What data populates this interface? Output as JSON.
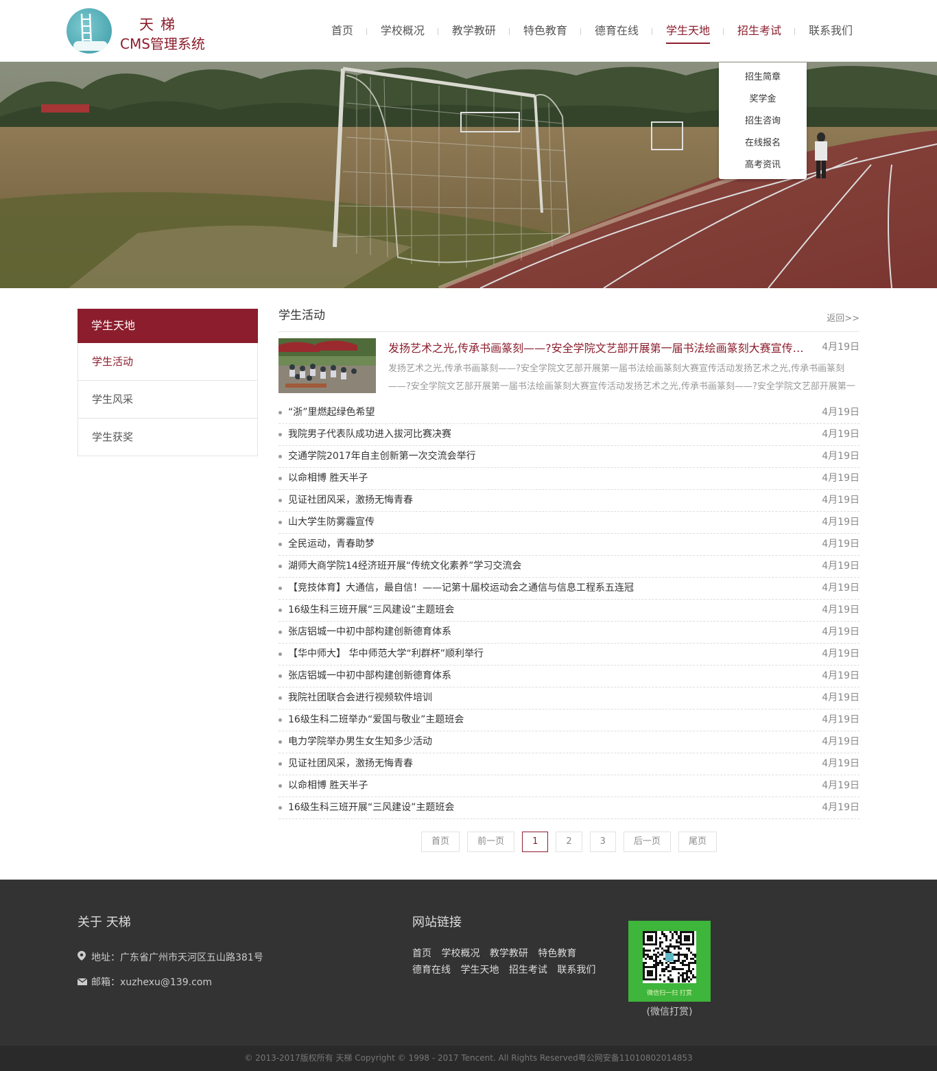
{
  "brand": {
    "name": "天梯",
    "subtitle": "CMS管理系统"
  },
  "nav": {
    "items": [
      {
        "label": "首页"
      },
      {
        "label": "学校概况"
      },
      {
        "label": "教学教研"
      },
      {
        "label": "特色教育"
      },
      {
        "label": "德育在线"
      },
      {
        "label": "学生天地"
      },
      {
        "label": "招生考试"
      },
      {
        "label": "联系我们"
      }
    ],
    "active": "学生天地",
    "hovered": "招生考试"
  },
  "dropdown": {
    "items": [
      {
        "label": "招生简章"
      },
      {
        "label": "奖学金"
      },
      {
        "label": "招生咨询"
      },
      {
        "label": "在线报名"
      },
      {
        "label": "高考资讯"
      }
    ]
  },
  "sidebar": {
    "title": "学生天地",
    "items": [
      {
        "label": "学生活动"
      },
      {
        "label": "学生风采"
      },
      {
        "label": "学生获奖"
      }
    ],
    "current": "学生活动"
  },
  "content": {
    "title": "学生活动",
    "back_label": "返回>>",
    "featured": {
      "title": "发扬艺术之光,传承书画篆刻——?安全学院文艺部开展第一届书法绘画篆刻大赛宣传活动",
      "date": "4月19日",
      "summary": "发扬艺术之光,传承书画篆刻——?安全学院文艺部开展第一届书法绘画篆刻大赛宣传活动发扬艺术之光,传承书画篆刻——?安全学院文艺部开展第一届书法绘画篆刻大赛宣传活动发扬艺术之光,传承书画篆刻——?安全学院文艺部开展第一届书法绘画篆刻大赛宣传活动"
    },
    "news": [
      {
        "title": "“浙”里燃起绿色希望",
        "date": "4月19日"
      },
      {
        "title": "我院男子代表队成功进入拔河比赛决赛",
        "date": "4月19日"
      },
      {
        "title": "交通学院2017年自主创新第一次交流会举行",
        "date": "4月19日"
      },
      {
        "title": "以命相博 胜天半子",
        "date": "4月19日"
      },
      {
        "title": "见证社团风采，激扬无悔青春",
        "date": "4月19日"
      },
      {
        "title": "山大学生防雾霾宣传",
        "date": "4月19日"
      },
      {
        "title": "全民运动，青春助梦",
        "date": "4月19日"
      },
      {
        "title": "湖师大商学院14经济班开展“传统文化素养”学习交流会",
        "date": "4月19日"
      },
      {
        "title": "【竞技体育】大通信，最自信！——记第十届校运动会之通信与信息工程系五连冠",
        "date": "4月19日"
      },
      {
        "title": "16级生科三班开展“三风建设”主题班会",
        "date": "4月19日"
      },
      {
        "title": "张店铝城一中初中部构建创新德育体系",
        "date": "4月19日"
      },
      {
        "title": "【华中师大】 华中师范大学“利群杯”顺利举行",
        "date": "4月19日"
      },
      {
        "title": "张店铝城一中初中部构建创新德育体系",
        "date": "4月19日"
      },
      {
        "title": "我院社团联合会进行视频软件培训",
        "date": "4月19日"
      },
      {
        "title": "16级生科二班举办“爱国与敬业”主题班会",
        "date": "4月19日"
      },
      {
        "title": "电力学院举办男生女生知多少活动",
        "date": "4月19日"
      },
      {
        "title": "见证社团风采，激扬无悔青春",
        "date": "4月19日"
      },
      {
        "title": "以命相博 胜天半子",
        "date": "4月19日"
      },
      {
        "title": "16级生科三班开展“三风建设”主题班会",
        "date": "4月19日"
      }
    ]
  },
  "pager": {
    "first": "首页",
    "prev": "前一页",
    "pages": [
      "1",
      "2",
      "3"
    ],
    "current": "1",
    "next": "后一页",
    "last": "尾页"
  },
  "footer": {
    "about_title": "关于 天梯",
    "address": "地址：广东省广州市天河区五山路381号",
    "email": "邮箱：xuzhexu@139.com",
    "links_title": "网站链接",
    "links_row1": [
      "首页",
      "学校概况",
      "教学教研",
      "特色教育"
    ],
    "links_row2": [
      "德育在线",
      "学生天地",
      "招生考试",
      "联系我们"
    ],
    "qr_caption": "微信扫一扫 打赏",
    "qr_label": "(微信打赏)",
    "copyright": "© 2013-2017版权所有 天梯 Copyright © 1998 - 2017 Tencent. All Rights Reserved粤公网安备11010802014853"
  },
  "colors": {
    "brand": "#8b1d2c",
    "footer_bg": "#333333",
    "qr_green": "#3eb53b"
  },
  "icons": [
    "logo-ladder",
    "location-pin-icon",
    "mail-icon",
    "qr-code"
  ]
}
